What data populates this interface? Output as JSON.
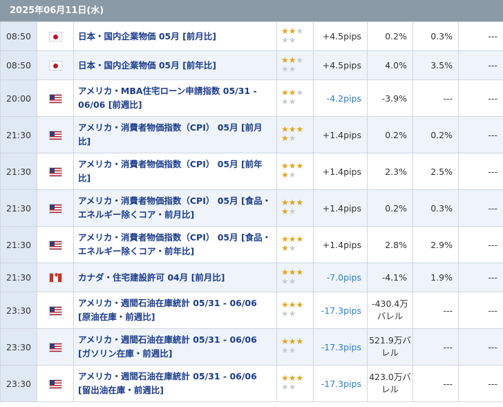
{
  "date": "2025年06月11日(水)",
  "colors": {
    "header_bg": "#8a99a6",
    "link": "#1a3b8e",
    "negative": "#2a7fd0",
    "star": "#e8a318"
  },
  "rows": [
    {
      "time": "08:50",
      "flag": "jp",
      "event": "日本・国内企業物価 05月 [前月比]",
      "stars": 2,
      "pips": "+4.5pips",
      "v1": "0.2%",
      "v2": "0.3%",
      "v3": "---"
    },
    {
      "time": "08:50",
      "flag": "jp",
      "event": "日本・国内企業物価 05月 [前年比]",
      "stars": 2,
      "pips": "+4.5pips",
      "v1": "4.0%",
      "v2": "3.5%",
      "v3": "---"
    },
    {
      "time": "20:00",
      "flag": "us",
      "event": "アメリカ・MBA住宅ローン申請指数 05/31 - 06/06 [前週比]",
      "stars": 2,
      "pips": "-4.2pips",
      "v1": "-3.9%",
      "v2": "---",
      "v3": "---"
    },
    {
      "time": "21:30",
      "flag": "us",
      "event": "アメリカ・消費者物価指数（CPI） 05月 [前月比]",
      "stars": 4,
      "pips": "+1.4pips",
      "v1": "0.2%",
      "v2": "0.2%",
      "v3": "---"
    },
    {
      "time": "21:30",
      "flag": "us",
      "event": "アメリカ・消費者物価指数（CPI） 05月 [前年比]",
      "stars": 4,
      "pips": "+1.4pips",
      "v1": "2.3%",
      "v2": "2.5%",
      "v3": "---"
    },
    {
      "time": "21:30",
      "flag": "us",
      "event": "アメリカ・消費者物価指数（CPI） 05月 [食品・エネルギー除くコア・前月比]",
      "stars": 4,
      "pips": "+1.4pips",
      "v1": "0.2%",
      "v2": "0.3%",
      "v3": "---"
    },
    {
      "time": "21:30",
      "flag": "us",
      "event": "アメリカ・消費者物価指数（CPI） 05月 [食品・エネルギー除くコア・前年比]",
      "stars": 4,
      "pips": "+1.4pips",
      "v1": "2.8%",
      "v2": "2.9%",
      "v3": "---"
    },
    {
      "time": "21:30",
      "flag": "ca",
      "event": "カナダ・住宅建設許可 04月 [前月比]",
      "stars": 3,
      "pips": "-7.0pips",
      "v1": "-4.1%",
      "v2": "1.9%",
      "v3": "---"
    },
    {
      "time": "23:30",
      "flag": "us",
      "event": "アメリカ・週間石油在庫統計 05/31 - 06/06 [原油在庫・前週比]",
      "stars": 3,
      "pips": "-17.3pips",
      "v1": "-430.4万バレル",
      "v2": "---",
      "v3": "---"
    },
    {
      "time": "23:30",
      "flag": "us",
      "event": "アメリカ・週間石油在庫統計 05/31 - 06/06 [ガソリン在庫・前週比]",
      "stars": 3,
      "pips": "-17.3pips",
      "v1": "521.9万バレル",
      "v2": "---",
      "v3": "---"
    },
    {
      "time": "23:30",
      "flag": "us",
      "event": "アメリカ・週間石油在庫統計 05/31 - 06/06 [留出油在庫・前週比]",
      "stars": 3,
      "pips": "-17.3pips",
      "v1": "423.0万バレル",
      "v2": "---",
      "v3": "---"
    }
  ]
}
